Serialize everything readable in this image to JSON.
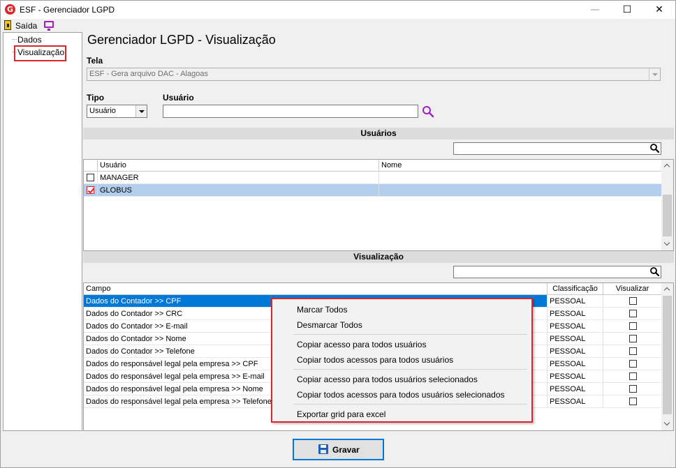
{
  "window": {
    "title": "ESF - Gerenciador LGPD",
    "logo_letter": "G",
    "minimize": "—",
    "maximize": "☐",
    "close": "✕"
  },
  "toolbar": {
    "exit_label": "Saída"
  },
  "tree": {
    "items": [
      "Dados",
      "Visualização"
    ],
    "selected": "Visualização"
  },
  "page": {
    "title": "Gerenciador LGPD - Visualização",
    "tela_label": "Tela",
    "tela_value": "ESF - Gera arquivo DAC - Alagoas",
    "tipo_label": "Tipo",
    "tipo_value": "Usuário",
    "usuario_label": "Usuário",
    "usuario_value": ""
  },
  "users_section": {
    "title": "Usuários",
    "search_value": "",
    "columns": [
      "Usuário",
      "Nome"
    ],
    "rows": [
      {
        "checked": false,
        "usuario": "MANAGER",
        "nome": ""
      },
      {
        "checked": true,
        "usuario": "GLOBUS",
        "nome": ""
      }
    ]
  },
  "view_section": {
    "title": "Visualização",
    "search_value": "",
    "columns": [
      "Campo",
      "Classificação",
      "Visualizar"
    ],
    "rows": [
      {
        "campo": "Dados do Contador >> CPF",
        "classificacao": "PESSOAL",
        "visualizar": false
      },
      {
        "campo": "Dados do Contador >> CRC",
        "classificacao": "PESSOAL",
        "visualizar": false
      },
      {
        "campo": "Dados do Contador >> E-mail",
        "classificacao": "PESSOAL",
        "visualizar": false
      },
      {
        "campo": "Dados do Contador >> Nome",
        "classificacao": "PESSOAL",
        "visualizar": false
      },
      {
        "campo": "Dados do Contador >> Telefone",
        "classificacao": "PESSOAL",
        "visualizar": false
      },
      {
        "campo": "Dados do responsável legal pela empresa >> CPF",
        "classificacao": "PESSOAL",
        "visualizar": false
      },
      {
        "campo": "Dados do responsável legal pela empresa >> E-mail",
        "classificacao": "PESSOAL",
        "visualizar": false
      },
      {
        "campo": "Dados do responsável legal pela empresa >> Nome",
        "classificacao": "PESSOAL",
        "visualizar": false
      },
      {
        "campo": "Dados do responsável legal pela empresa >> Telefone",
        "classificacao": "PESSOAL",
        "visualizar": false
      }
    ]
  },
  "context_menu": {
    "groups": [
      [
        "Marcar Todos",
        "Desmarcar Todos"
      ],
      [
        "Copiar acesso para todos usuários",
        "Copiar todos acessos para todos usuários"
      ],
      [
        "Copiar acesso para todos usuários selecionados",
        "Copiar todos acessos para todos usuários selecionados"
      ],
      [
        "Exportar grid para excel"
      ]
    ]
  },
  "footer": {
    "save_label": "Gravar"
  },
  "colors": {
    "accent_red": "#d9262a",
    "selection_blue": "#0078d7",
    "row_highlight": "#b3cdec",
    "search_purple": "#a020c0"
  }
}
